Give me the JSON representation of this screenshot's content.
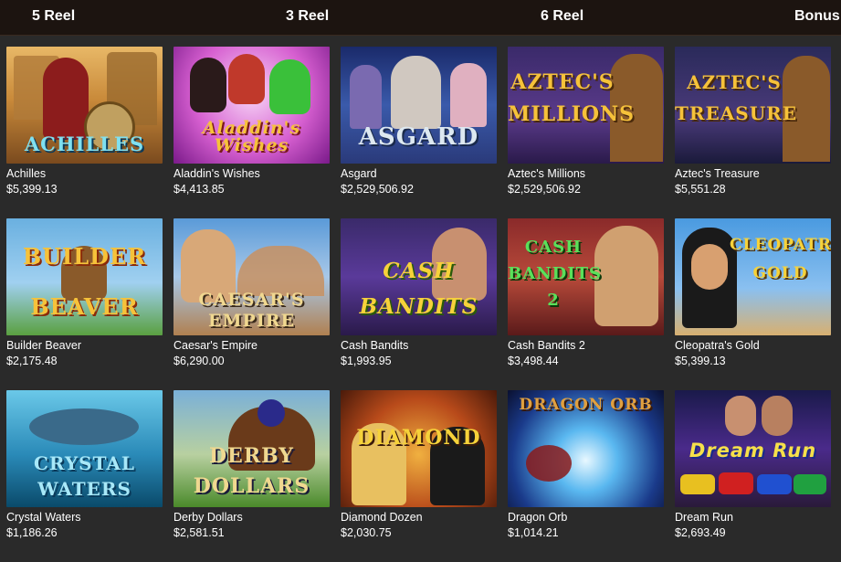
{
  "tabs": [
    "5 Reel",
    "3 Reel",
    "6 Reel",
    "Bonus"
  ],
  "games": [
    {
      "name": "Achilles",
      "jackpot": "$5,399.13",
      "logo": "ACHILLES"
    },
    {
      "name": "Aladdin's Wishes",
      "jackpot": "$4,413.85",
      "logo": "Aladdin's Wishes"
    },
    {
      "name": "Asgard",
      "jackpot": "$2,529,506.92",
      "logo": "ASGARD"
    },
    {
      "name": "Aztec's Millions",
      "jackpot": "$2,529,506.92",
      "logo": "AZTEC'S MILLIONS"
    },
    {
      "name": "Aztec's Treasure",
      "jackpot": "$5,551.28",
      "logo": "AZTEC'S TREASURE"
    },
    {
      "name": "Builder Beaver",
      "jackpot": "$2,175.48",
      "logo": "BUILDER BEAVER"
    },
    {
      "name": "Caesar's Empire",
      "jackpot": "$6,290.00",
      "logo": "CAESAR'S EMPIRE"
    },
    {
      "name": "Cash Bandits",
      "jackpot": "$1,993.95",
      "logo": "CASH BANDITS"
    },
    {
      "name": "Cash Bandits 2",
      "jackpot": "$3,498.44",
      "logo": "CASH BANDITS 2"
    },
    {
      "name": "Cleopatra's Gold",
      "jackpot": "$5,399.13",
      "logo": "CLEOPATRA'S GOLD"
    },
    {
      "name": "Crystal Waters",
      "jackpot": "$1,186.26",
      "logo": "CRYSTAL WATERS"
    },
    {
      "name": "Derby Dollars",
      "jackpot": "$2,581.51",
      "logo": "DERBY DOLLARS"
    },
    {
      "name": "Diamond Dozen",
      "jackpot": "$2,030.75",
      "logo": "DIAMOND DOZEN"
    },
    {
      "name": "Dragon Orb",
      "jackpot": "$1,014.21",
      "logo": "DRAGON ORB"
    },
    {
      "name": "Dream Run",
      "jackpot": "$2,693.49",
      "logo": "Dream Run"
    }
  ]
}
